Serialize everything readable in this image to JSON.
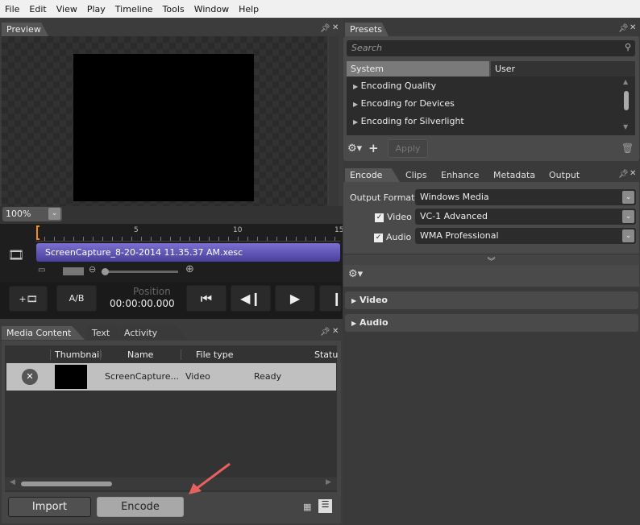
{
  "menu": [
    "File",
    "Edit",
    "View",
    "Play",
    "Timeline",
    "Tools",
    "Window",
    "Help"
  ],
  "preview": {
    "tab": "Preview",
    "zoom": "100%"
  },
  "timeline": {
    "ticks": [
      "5",
      "10",
      "15"
    ],
    "clip": "ScreenCapture_8-20-2014 11.35.37 AM.xesc",
    "clip_color": "#5a50b4"
  },
  "transport": {
    "ab": "A/B",
    "position_label": "Position",
    "position": "00:00:00.000"
  },
  "media": {
    "tabs": [
      "Media Content",
      "Text",
      "Activity Log"
    ],
    "columns": [
      "Thumbnail",
      "Name",
      "File type",
      "Statu"
    ],
    "rows": [
      {
        "name": "ScreenCapture...",
        "type": "Video",
        "status": "Ready"
      }
    ],
    "import": "Import",
    "encode": "Encode"
  },
  "presets": {
    "tab": "Presets",
    "search_placeholder": "Search",
    "tabs": [
      "System",
      "User"
    ],
    "items": [
      "Encoding Quality",
      "Encoding for Devices",
      "Encoding for Silverlight"
    ],
    "apply": "Apply"
  },
  "encode": {
    "tabs": [
      "Encode",
      "Clips",
      "Enhance",
      "Metadata",
      "Output"
    ],
    "output_format_label": "Output Format",
    "output_format": "Windows Media",
    "video_label": "Video",
    "video": "VC-1 Advanced",
    "audio_label": "Audio",
    "audio": "WMA Professional",
    "sections": [
      "Video",
      "Audio"
    ]
  },
  "annotation_color": "#e8615f"
}
